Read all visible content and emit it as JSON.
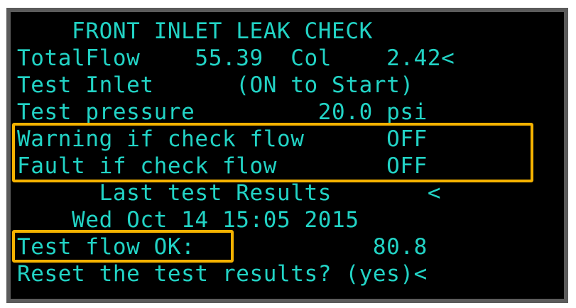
{
  "screen": {
    "title": "    FRONT INLET LEAK CHECK",
    "lines": [
      "TotalFlow    55.39  Col    2.42<",
      "Test Inlet      (ON to Start)",
      "Test pressure         20.0 psi",
      "Warning if check flow      OFF",
      "Fault if check flow        OFF",
      "      Last test Results       <",
      "    Wed Oct 14 15:05 2015",
      "Test flow OK:             80.8",
      "Reset the test results? (yes)<"
    ]
  },
  "colors": {
    "text": "#22d3c5",
    "background": "#000000",
    "highlight": "#f5b200"
  }
}
